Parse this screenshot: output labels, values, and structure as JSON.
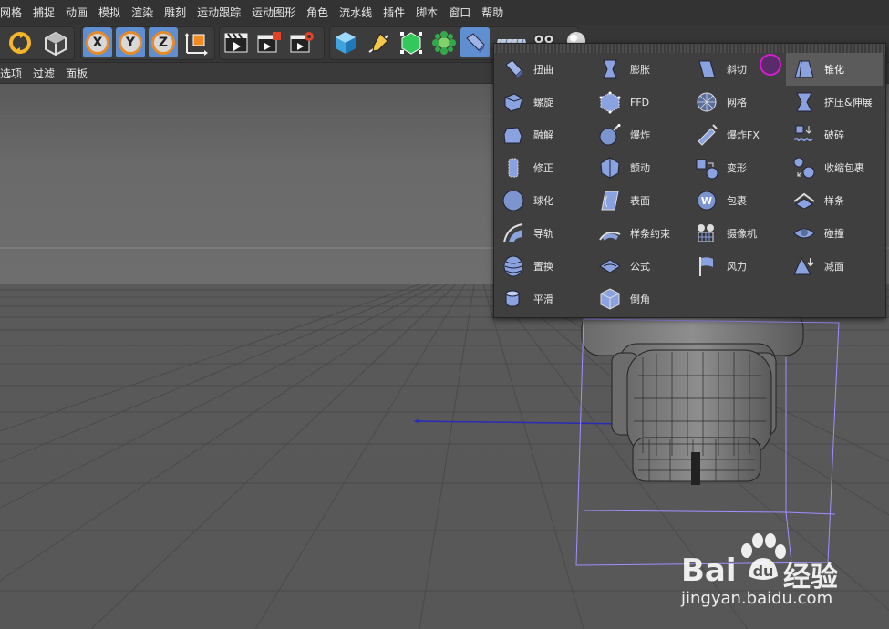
{
  "menu": [
    "网格",
    "捕捉",
    "动画",
    "模拟",
    "渲染",
    "雕刻",
    "运动跟踪",
    "运动图形",
    "角色",
    "流水线",
    "插件",
    "脚本",
    "窗口",
    "帮助"
  ],
  "viewport_menu": [
    "选项",
    "过滤",
    "面板"
  ],
  "toolbar": {
    "axis_x": "X",
    "axis_y": "Y",
    "axis_z": "Z"
  },
  "deformers": {
    "col1": [
      "扭曲",
      "螺旋",
      "融解",
      "修正",
      "球化",
      "导轨",
      "置换",
      "平滑"
    ],
    "col2": [
      "膨胀",
      "FFD",
      "爆炸",
      "颤动",
      "表面",
      "样条约束",
      "公式",
      "倒角"
    ],
    "col3": [
      "斜切",
      "网格",
      "爆炸FX",
      "变形",
      "包裹",
      "摄像机",
      "风力"
    ],
    "col4": [
      "锥化",
      "挤压&伸展",
      "破碎",
      "收缩包裹",
      "样条",
      "碰撞",
      "减面"
    ],
    "selected": "锥化"
  },
  "watermark": {
    "brand_left": "Bai",
    "brand_right": "经验",
    "url": "jingyan.baidu.com"
  },
  "colors": {
    "accent_orange": "#e58b2a",
    "icon_blue": "#7d95cf",
    "bbox_purple": "#a48cff",
    "highlight_magenta": "#d21fd0"
  }
}
